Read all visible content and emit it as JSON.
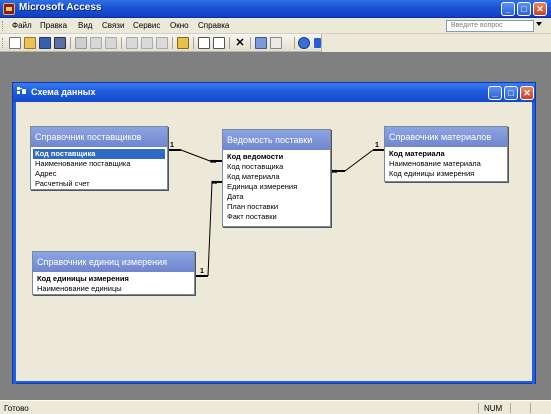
{
  "app": {
    "title": "Microsoft Access"
  },
  "window_controls": {
    "min": "_",
    "max": "□",
    "close": "✕"
  },
  "menu": {
    "items": [
      "Файл",
      "Правка",
      "Вид",
      "Связи",
      "Сервис",
      "Окно",
      "Справка"
    ],
    "help_placeholder": "Введите вопрос"
  },
  "toolbar": {
    "icons": [
      "new-icon",
      "open-icon",
      "save-icon",
      "print-preview-icon",
      "print-icon",
      "print2-icon",
      "spell-icon",
      "cut-icon",
      "copy-icon",
      "paste-icon",
      "show-table-icon",
      "direct-relations-icon",
      "all-relations-icon",
      "delete-icon",
      "database-window-icon",
      "new-object-icon",
      "help-icon"
    ]
  },
  "window": {
    "title": "Схема данных"
  },
  "tables": {
    "suppliers": {
      "title": "Справочник поставщиков",
      "fields": [
        "Код поставщика",
        "Наименование поставщика",
        "Адрес",
        "Расчетный счет"
      ],
      "key_index": 0
    },
    "delivery": {
      "title": "Ведомость поставки",
      "fields": [
        "Код ведомости",
        "Код поставщика",
        "Код материала",
        "Единица измерения",
        "Дата",
        "План поставки",
        "Факт поставки"
      ],
      "key_index": 0
    },
    "materials": {
      "title": "Справочник материалов",
      "fields": [
        "Код материала",
        "Наименование материала",
        "Код единицы измерения"
      ],
      "key_index": 0
    },
    "units": {
      "title": "Справочник единиц измерения",
      "fields": [
        "Код единицы измерения",
        "Наименование единицы"
      ],
      "key_index": 0
    }
  },
  "relationships": {
    "one": "1",
    "many": "∞"
  },
  "status": {
    "text": "Готово",
    "num": "NUM"
  },
  "colors": {
    "titlebar": "#1a53d4",
    "table_header": "#7b92d8",
    "selection": "#316ac5",
    "face": "#ece9d8"
  }
}
